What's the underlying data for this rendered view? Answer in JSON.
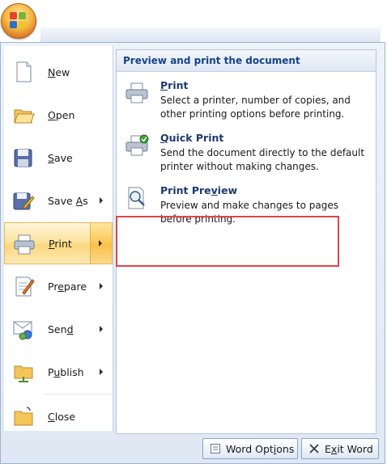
{
  "left_menu": {
    "items": [
      {
        "label_pre": "",
        "underline": "N",
        "label_post": "ew",
        "icon": "new-document-icon",
        "has_arrow": false
      },
      {
        "label_pre": "",
        "underline": "O",
        "label_post": "pen",
        "icon": "open-folder-icon",
        "has_arrow": false
      },
      {
        "label_pre": "",
        "underline": "S",
        "label_post": "ave",
        "icon": "save-disk-icon",
        "has_arrow": false
      },
      {
        "label_pre": "Save ",
        "underline": "A",
        "label_post": "s",
        "icon": "save-as-icon",
        "has_arrow": true
      },
      {
        "label_pre": "",
        "underline": "P",
        "label_post": "rint",
        "icon": "printer-icon",
        "has_arrow": true
      },
      {
        "label_pre": "Pr",
        "underline": "e",
        "label_post": "pare",
        "icon": "prepare-icon",
        "has_arrow": true
      },
      {
        "label_pre": "Sen",
        "underline": "d",
        "label_post": "",
        "icon": "send-icon",
        "has_arrow": true
      },
      {
        "label_pre": "P",
        "underline": "u",
        "label_post": "blish",
        "icon": "publish-icon",
        "has_arrow": true
      },
      {
        "label_pre": "",
        "underline": "C",
        "label_post": "lose",
        "icon": "close-folder-icon",
        "has_arrow": false
      }
    ]
  },
  "submenu": {
    "header": "Preview and print the document",
    "items": [
      {
        "title_pre": "",
        "title_u": "P",
        "title_post": "rint",
        "desc": "Select a printer, number of copies, and other printing options before printing."
      },
      {
        "title_pre": "",
        "title_u": "Q",
        "title_post": "uick Print",
        "desc": "Send the document directly to the default printer without making changes."
      },
      {
        "title_pre": "Print Pre",
        "title_u": "v",
        "title_post": "iew",
        "desc": "Preview and make changes to pages before printing."
      }
    ]
  },
  "buttons": {
    "options_pre": "Word Opt",
    "options_u": "i",
    "options_post": "ons",
    "exit_pre": "E",
    "exit_u": "x",
    "exit_post": "it Word"
  },
  "colors": {
    "accent_header": "#15428b",
    "highlight_border": "#e04545",
    "active_item": "#fbd77f"
  }
}
